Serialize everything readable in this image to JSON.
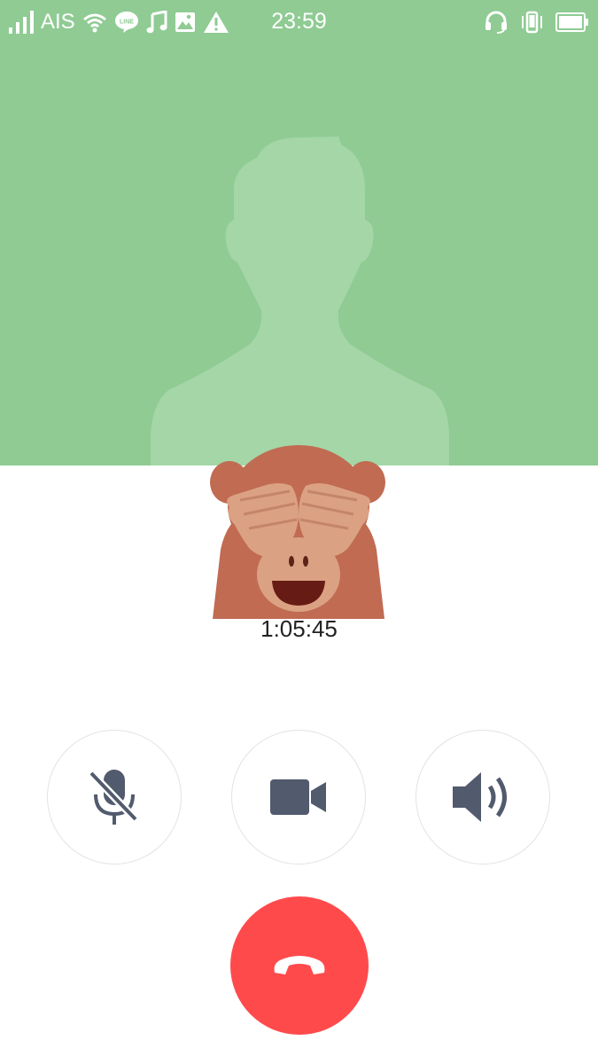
{
  "status_bar": {
    "carrier": "AIS",
    "time": "23:59",
    "icons_left": [
      "signal-icon",
      "wifi-icon",
      "line-app-icon",
      "music-note-icon",
      "image-icon",
      "warning-icon"
    ],
    "icons_right": [
      "headset-icon",
      "vibrate-icon",
      "battery-icon"
    ],
    "line_badge": "LINE"
  },
  "call": {
    "duration": "1:05:45",
    "background_color": "#8fcb93",
    "avatar": "see-no-evil-monkey-sticker"
  },
  "controls": {
    "mute": {
      "icon": "mic-off-icon",
      "state": "muted"
    },
    "video": {
      "icon": "video-camera-icon"
    },
    "speaker": {
      "icon": "speaker-icon"
    },
    "end_call": {
      "icon": "hang-up-icon",
      "color": "#ff4a4c"
    }
  },
  "colors": {
    "icon": "#525a6e",
    "button_border": "#e3e3e3",
    "silhouette": "#a4d6a7"
  }
}
